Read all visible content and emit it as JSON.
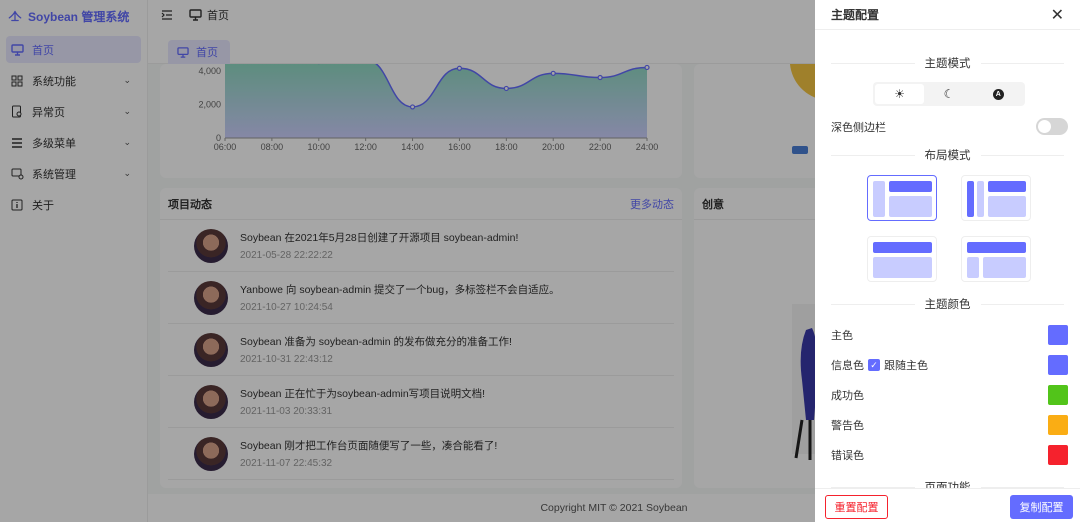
{
  "app": {
    "name": "Soybean 管理系统"
  },
  "sidebar": {
    "items": [
      {
        "label": "首页",
        "icon": "monitor-icon",
        "active": true,
        "expandable": false
      },
      {
        "label": "系统功能",
        "icon": "grid-icon",
        "expandable": true
      },
      {
        "label": "异常页",
        "icon": "doc-search-icon",
        "expandable": true
      },
      {
        "label": "多级菜单",
        "icon": "menu-lines-icon",
        "expandable": true
      },
      {
        "label": "系统管理",
        "icon": "settings-screen-icon",
        "expandable": true
      },
      {
        "label": "关于",
        "icon": "info-icon",
        "expandable": false
      }
    ]
  },
  "header": {
    "breadcrumb": "首页"
  },
  "tabs": [
    {
      "label": "首页"
    }
  ],
  "chart_data": {
    "type": "area",
    "x": [
      "06:00",
      "08:00",
      "10:00",
      "12:00",
      "14:00",
      "16:00",
      "18:00",
      "20:00",
      "22:00",
      "24:00"
    ],
    "series": [
      {
        "values": [
          4700,
          4600,
          4550,
          4650,
          1850,
          4150,
          2950,
          3850,
          3600,
          4200
        ]
      }
    ],
    "yticks": [
      "0",
      "2,000",
      "4,000"
    ],
    "ylim": [
      0,
      5000
    ],
    "colors": {
      "line": "#646cff",
      "fill_top": "#7fd6b7",
      "fill_bottom": "#c8ccff"
    }
  },
  "feed": {
    "title": "项目动态",
    "more": "更多动态",
    "items": [
      {
        "text": "Soybean 在2021年5月28日创建了开源项目 soybean-admin!",
        "time": "2021-05-28 22:22:22"
      },
      {
        "text": "Yanbowe 向 soybean-admin 提交了一个bug，多标签栏不会自适应。",
        "time": "2021-10-27 10:24:54"
      },
      {
        "text": "Soybean 准备为 soybean-admin 的发布做充分的准备工作!",
        "time": "2021-10-31 22:43:12"
      },
      {
        "text": "Soybean 正在忙于为soybean-admin写项目说明文档!",
        "time": "2021-11-03 20:33:31"
      },
      {
        "text": "Soybean 刚才把工作台页面随便写了一些，凑合能看了!",
        "time": "2021-11-07 22:45:32"
      }
    ]
  },
  "creative": {
    "title": "创意"
  },
  "footer": {
    "text": "Copyright MIT © 2021 Soybean"
  },
  "drawer": {
    "title": "主题配置",
    "sections": {
      "theme_mode": "主题模式",
      "layout_mode": "布局模式",
      "theme_color": "主题颜色",
      "page_func": "页面功能"
    },
    "dark_sidebar": {
      "label": "深色侧边栏",
      "on": false
    },
    "mode_icons": [
      "sun-icon",
      "moon-icon",
      "auto-icon"
    ],
    "mode_selected": 0,
    "colors": [
      {
        "label": "主色",
        "color": "#646cff"
      },
      {
        "label": "信息色",
        "color": "#646cff",
        "follow": "跟随主色"
      },
      {
        "label": "成功色",
        "color": "#52c41a"
      },
      {
        "label": "警告色",
        "color": "#faad14"
      },
      {
        "label": "错误色",
        "color": "#f5222d"
      }
    ],
    "reset": "重置配置",
    "copy": "复制配置"
  }
}
